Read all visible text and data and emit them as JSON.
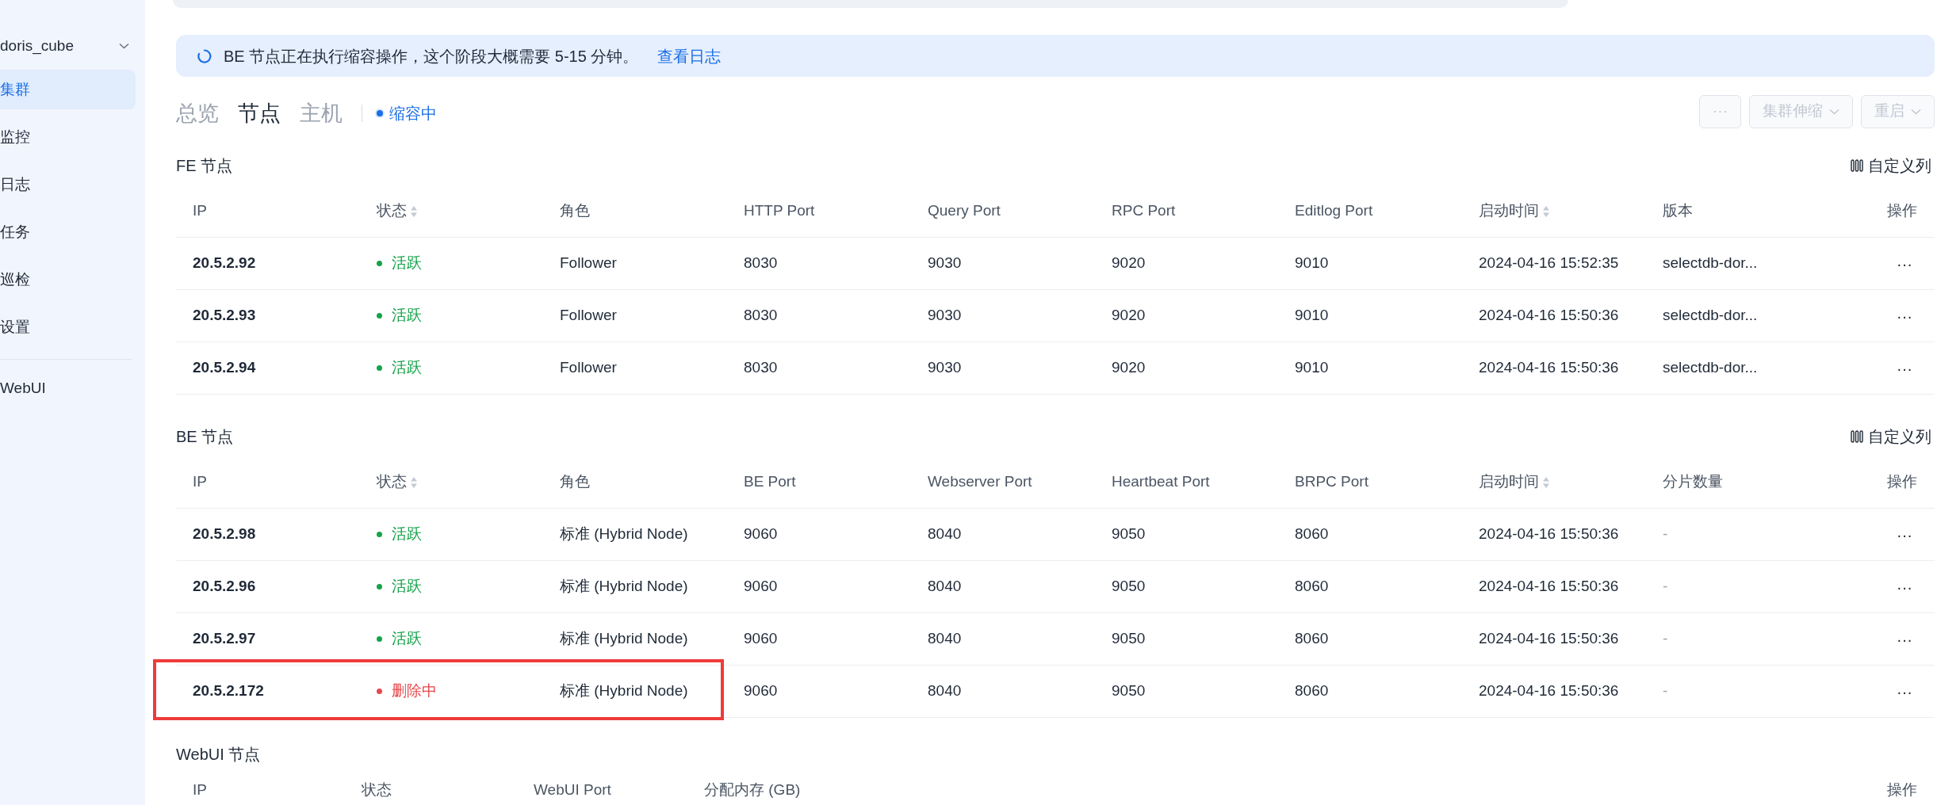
{
  "sidebar": {
    "cluster_name": "doris_cube",
    "items": [
      {
        "label": "集群",
        "selected": true
      },
      {
        "label": "监控",
        "selected": false
      },
      {
        "label": "日志",
        "selected": false
      },
      {
        "label": "任务",
        "selected": false
      },
      {
        "label": "巡检",
        "selected": false
      },
      {
        "label": "设置",
        "selected": false
      }
    ],
    "footer_item": "WebUI"
  },
  "banner": {
    "text": "BE 节点正在执行缩容操作，这个阶段大概需要 5-15 分钟。",
    "link": "查看日志"
  },
  "tabs": [
    {
      "label": "总览",
      "selected": false
    },
    {
      "label": "节点",
      "selected": true
    },
    {
      "label": "主机",
      "selected": false
    }
  ],
  "cluster_status": "缩容中",
  "actions": [
    {
      "label": "···",
      "dropdown": false,
      "disabled": true
    },
    {
      "label": "集群伸缩",
      "dropdown": true,
      "disabled": true
    },
    {
      "label": "重启",
      "dropdown": true,
      "disabled": true
    }
  ],
  "fe_section": {
    "title": "FE 节点",
    "customize": "自定义列",
    "columns": [
      {
        "label": "IP",
        "sortable": false
      },
      {
        "label": "状态",
        "sortable": true
      },
      {
        "label": "角色",
        "sortable": false
      },
      {
        "label": "HTTP Port",
        "sortable": false
      },
      {
        "label": "Query Port",
        "sortable": false
      },
      {
        "label": "RPC Port",
        "sortable": false
      },
      {
        "label": "Editlog Port",
        "sortable": false
      },
      {
        "label": "启动时间",
        "sortable": true
      },
      {
        "label": "版本",
        "sortable": false
      },
      {
        "label": "操作",
        "sortable": false
      }
    ],
    "rows": [
      {
        "cells": [
          "20.5.2.92",
          "活跃",
          "Follower",
          "8030",
          "9030",
          "9020",
          "9010",
          "2024-04-16 15:52:35",
          "selectdb-dor...",
          "···"
        ],
        "color": "#16a34a",
        "highlighted": false
      },
      {
        "cells": [
          "20.5.2.93",
          "活跃",
          "Follower",
          "8030",
          "9030",
          "9020",
          "9010",
          "2024-04-16 15:50:36",
          "selectdb-dor...",
          "···"
        ],
        "color": "#16a34a",
        "highlighted": false
      },
      {
        "cells": [
          "20.5.2.94",
          "活跃",
          "Follower",
          "8030",
          "9030",
          "9020",
          "9010",
          "2024-04-16 15:50:36",
          "selectdb-dor...",
          "···"
        ],
        "color": "#16a34a",
        "highlighted": false
      }
    ]
  },
  "be_section": {
    "title": "BE 节点",
    "customize": "自定义列",
    "columns": [
      {
        "label": "IP",
        "sortable": false
      },
      {
        "label": "状态",
        "sortable": true
      },
      {
        "label": "角色",
        "sortable": false
      },
      {
        "label": "BE Port",
        "sortable": false
      },
      {
        "label": "Webserver Port",
        "sortable": false
      },
      {
        "label": "Heartbeat Port",
        "sortable": false
      },
      {
        "label": "BRPC Port",
        "sortable": false
      },
      {
        "label": "启动时间",
        "sortable": true
      },
      {
        "label": "分片数量",
        "sortable": false
      },
      {
        "label": "操作",
        "sortable": false
      }
    ],
    "rows": [
      {
        "cells": [
          "20.5.2.98",
          "活跃",
          "标准 (Hybrid Node)",
          "9060",
          "8040",
          "9050",
          "8060",
          "2024-04-16 15:50:36",
          "-",
          "···"
        ],
        "color": "#16a34a",
        "highlighted": false
      },
      {
        "cells": [
          "20.5.2.96",
          "活跃",
          "标准 (Hybrid Node)",
          "9060",
          "8040",
          "9050",
          "8060",
          "2024-04-16 15:50:36",
          "-",
          "···"
        ],
        "color": "#16a34a",
        "highlighted": false
      },
      {
        "cells": [
          "20.5.2.97",
          "活跃",
          "标准 (Hybrid Node)",
          "9060",
          "8040",
          "9050",
          "8060",
          "2024-04-16 15:50:36",
          "-",
          "···"
        ],
        "color": "#16a34a",
        "highlighted": false
      },
      {
        "cells": [
          "20.5.2.172",
          "删除中",
          "标准 (Hybrid Node)",
          "9060",
          "8040",
          "9050",
          "8060",
          "2024-04-16 15:50:36",
          "-",
          "···"
        ],
        "color": "#e5484d",
        "highlighted": true
      }
    ]
  },
  "webui_section": {
    "title": "WebUI 节点",
    "columns": [
      "IP",
      "状态",
      "WebUI Port",
      "分配内存 (GB)",
      "操作"
    ]
  }
}
